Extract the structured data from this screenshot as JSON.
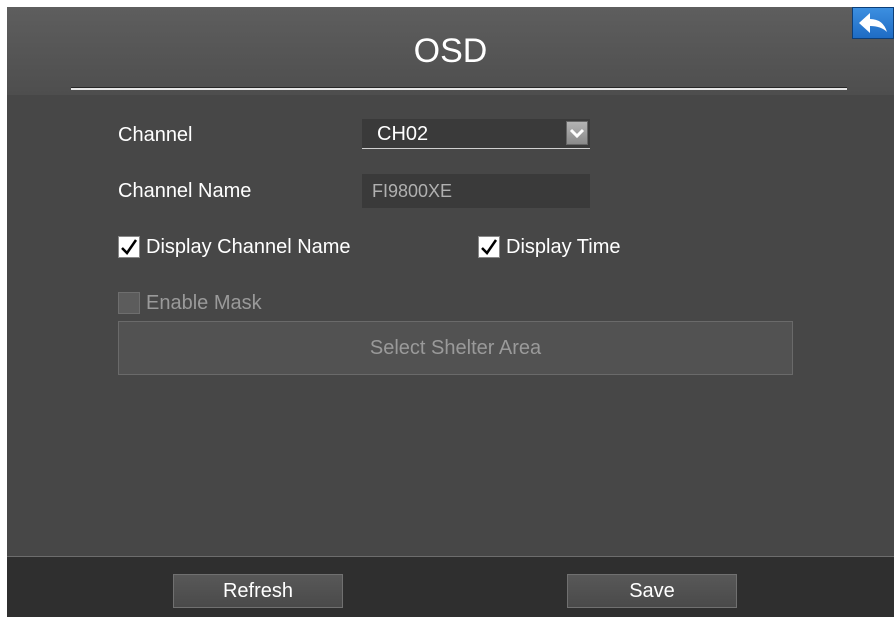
{
  "header": {
    "title": "OSD",
    "back_icon": "back-arrow-icon",
    "accent_color": "#2a7ad6"
  },
  "form": {
    "channel": {
      "label": "Channel",
      "value": "CH02"
    },
    "channel_name": {
      "label": "Channel Name",
      "value": "FI9800XE"
    },
    "display_channel_name": {
      "label": "Display Channel Name",
      "checked": true
    },
    "display_time": {
      "label": "Display Time",
      "checked": true
    },
    "enable_mask": {
      "label": "Enable Mask",
      "checked": false,
      "disabled": true
    },
    "select_shelter_area": {
      "label": "Select Shelter Area",
      "disabled": true
    }
  },
  "footer": {
    "refresh_label": "Refresh",
    "save_label": "Save"
  }
}
